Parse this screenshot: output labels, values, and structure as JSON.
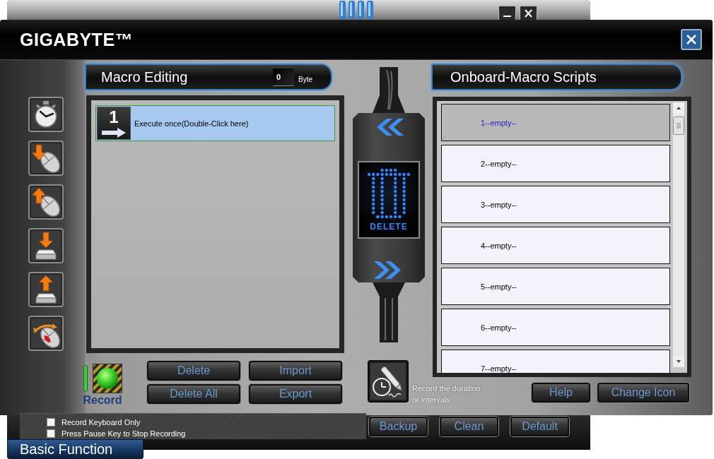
{
  "back_window": {
    "tab": "Basic Function",
    "buttons": [
      "Backup",
      "Clean",
      "Default"
    ]
  },
  "window": {
    "logo": "GIGABYTE™"
  },
  "macro_editing": {
    "title": "Macro Editing",
    "byte_count": "0",
    "byte_unit": "Byte",
    "steps": [
      {
        "count": "1",
        "label": "Execute once(Double-Click here)",
        "selected": true
      }
    ],
    "record_label": "Record",
    "buttons": [
      "Delete",
      "Import",
      "Delete All",
      "Export"
    ]
  },
  "transfer": {
    "label": "DELETE"
  },
  "duration": {
    "hint": "Record the duration or intervals"
  },
  "scripts": {
    "title": "Onboard-Macro Scripts",
    "slots": [
      {
        "label": "1--empty--",
        "selected": true
      },
      {
        "label": "2--empty--",
        "selected": false
      },
      {
        "label": "3--empty--",
        "selected": false
      },
      {
        "label": "4--empty--",
        "selected": false
      },
      {
        "label": "5--empty--",
        "selected": false
      },
      {
        "label": "6--empty--",
        "selected": false
      },
      {
        "label": "7--empty--",
        "selected": false
      }
    ],
    "buttons": [
      "Help",
      "Change Icon"
    ]
  },
  "options": [
    {
      "label": "Record Keyboard Only",
      "checked": false
    },
    {
      "label": "Press Pause Key to Stop Recording",
      "checked": false
    }
  ]
}
